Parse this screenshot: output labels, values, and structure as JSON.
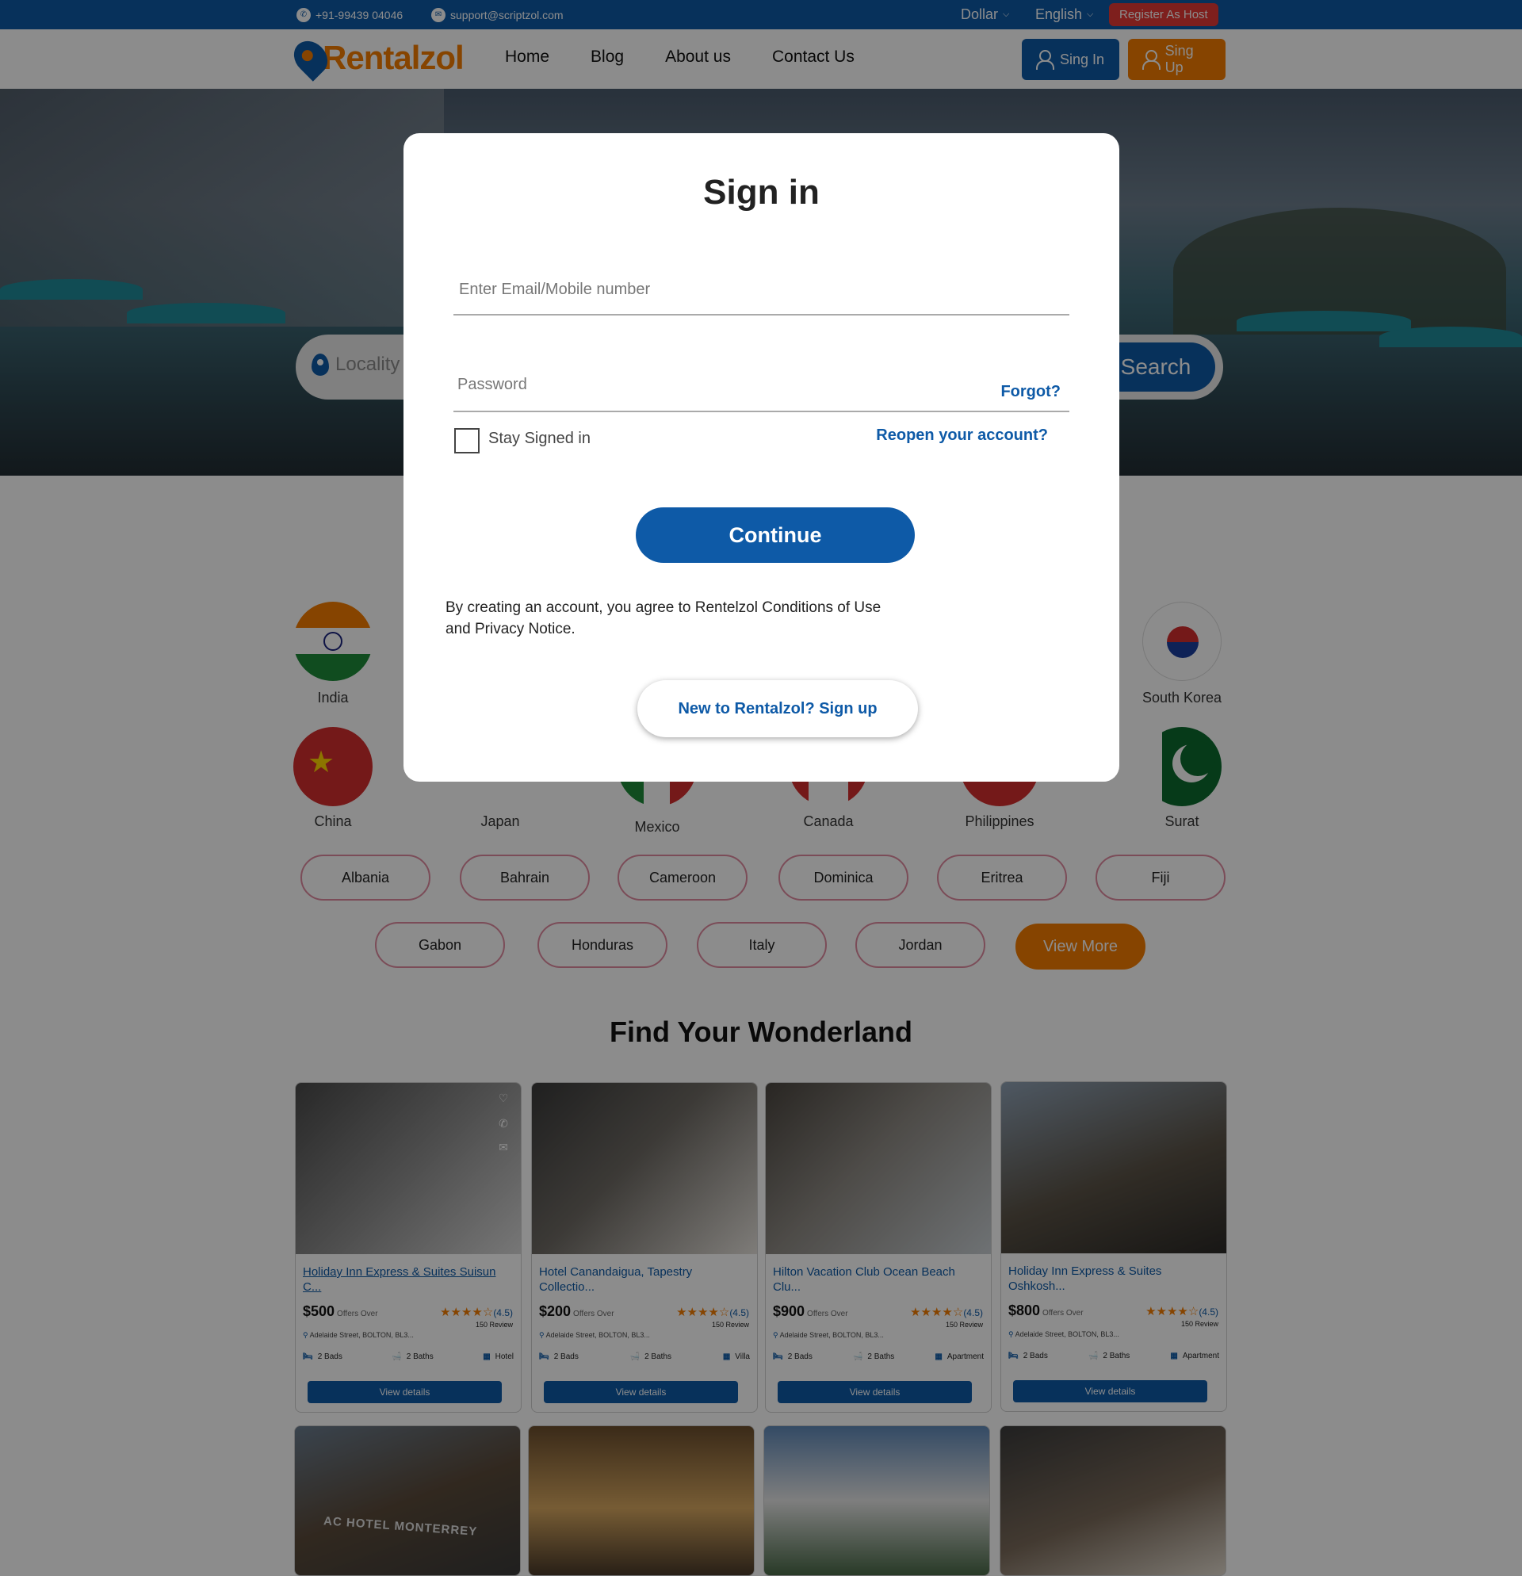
{
  "topbar": {
    "phone": "+91-99439 04046",
    "email": "support@scriptzol.com",
    "currency": "Dollar",
    "language": "English",
    "register_host": "Register As Host"
  },
  "header": {
    "logo_text": "Rentalzol",
    "nav": [
      "Home",
      "Blog",
      "About us",
      "Contact Us"
    ],
    "sign_in": "Sing In",
    "sign_up": "Sing Up"
  },
  "hero": {
    "search_placeholder": "Locality",
    "search_button": "Search"
  },
  "countries_row1": [
    "India",
    "South Korea"
  ],
  "countries_row2": [
    "China",
    "Japan",
    "Mexico",
    "Canada",
    "Philippines",
    "Surat"
  ],
  "pills_row1": [
    "Albania",
    "Bahrain",
    "Cameroon",
    "Dominica",
    "Eritrea",
    "Fiji"
  ],
  "pills_row2": [
    "Gabon",
    "Honduras",
    "Italy",
    "Jordan"
  ],
  "view_more": "View More",
  "section_title": "Find Your Wonderland",
  "cards": [
    {
      "title": "Holiday Inn Express & Suites Suisun C...",
      "price": "$500",
      "offer": "Offers Over",
      "rating": "(4.5)",
      "reviews": "150 Review",
      "address": "Adelaide Street, BOLTON, BL3...",
      "beds": "2 Bads",
      "baths": "2 Baths",
      "type": "Hotel",
      "button": "View details"
    },
    {
      "title": "Hotel Canandaigua, Tapestry Collectio...",
      "price": "$200",
      "offer": "Offers Over",
      "rating": "(4.5)",
      "reviews": "150 Review",
      "address": "Adelaide Street, BOLTON, BL3...",
      "beds": "2 Bads",
      "baths": "2 Baths",
      "type": "Villa",
      "button": "View details"
    },
    {
      "title": "Hilton Vacation Club Ocean Beach Clu...",
      "price": "$900",
      "offer": "Offers Over",
      "rating": "(4.5)",
      "reviews": "150 Review",
      "address": "Adelaide Street, BOLTON, BL3...",
      "beds": "2 Bads",
      "baths": "2 Baths",
      "type": "Apartment",
      "button": "View details"
    },
    {
      "title": "Holiday Inn Express & Suites Oshkosh...",
      "price": "$800",
      "offer": "Offers Over",
      "rating": "(4.5)",
      "reviews": "150 Review",
      "address": "Adelaide Street, BOLTON, BL3...",
      "beds": "2 Bads",
      "baths": "2 Baths",
      "type": "Apartment",
      "button": "View details"
    }
  ],
  "card_row2_sign": "AC HOTEL MONTERREY",
  "modal": {
    "title": "Sign in",
    "email_placeholder": "Enter Email/Mobile number",
    "password_placeholder": "Password",
    "forgot": "Forgot?",
    "stay_signed": "Stay Signed in",
    "reopen": "Reopen your account?",
    "continue": "Continue",
    "terms": "By creating an account, you agree to Rentelzol Conditions of Use and Privacy Notice.",
    "signup": "New to Rentalzol? Sign up"
  },
  "colors": {
    "primary": "#0e5aa7",
    "accent": "#f57c00",
    "danger": "#e53935"
  }
}
